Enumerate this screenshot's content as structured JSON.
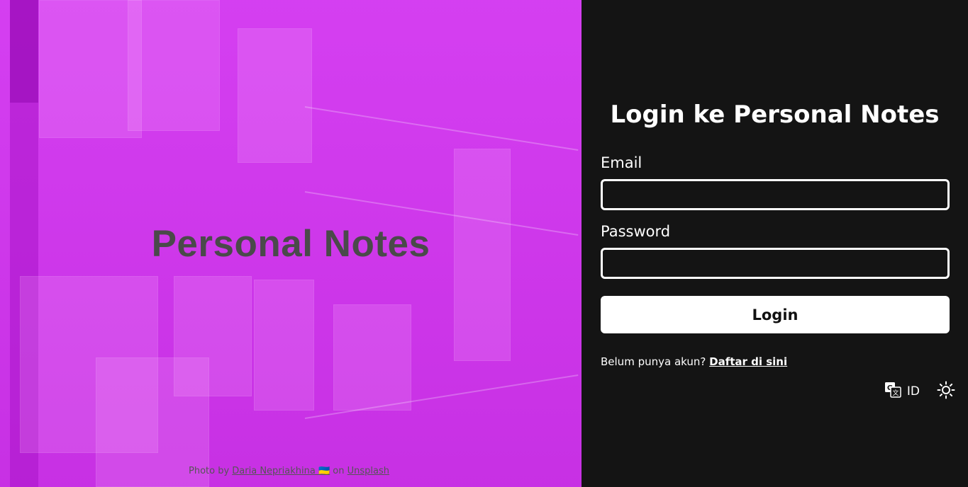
{
  "hero": {
    "title": "Personal Notes",
    "credit": {
      "prefix": "Photo by",
      "author": "Daria Nepriakhina 🇺🇦",
      "middle": "on",
      "site": "Unsplash"
    },
    "background_color": "#d233f0"
  },
  "login": {
    "heading": "Login ke Personal Notes",
    "email": {
      "label": "Email",
      "value": "",
      "placeholder": ""
    },
    "password": {
      "label": "Password",
      "value": "",
      "placeholder": ""
    },
    "submit_label": "Login",
    "register_prompt": "Belum punya akun?",
    "register_link": "Daftar di sini"
  },
  "controls": {
    "language_icon": "translate-icon",
    "language_code": "ID",
    "theme_icon": "sun-icon"
  },
  "colors": {
    "panel_bg": "#141414",
    "text": "#ffffff",
    "button_bg": "#ffffff",
    "button_text": "#111111",
    "hero_title": "#4a4a4a"
  }
}
